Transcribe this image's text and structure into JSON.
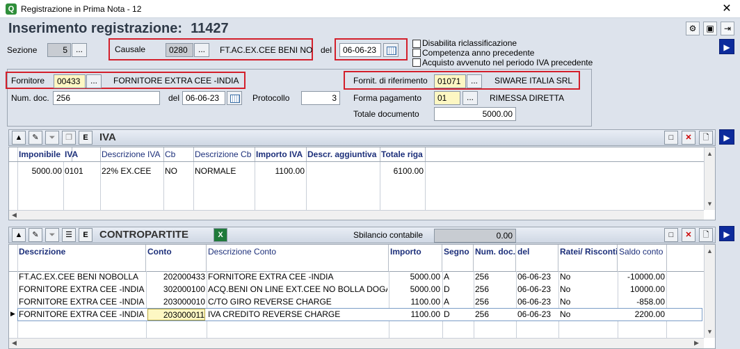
{
  "window": {
    "title": "Registrazione in Prima Nota - 12",
    "close_glyph": "✕"
  },
  "header": {
    "title": "Inserimento registrazione:",
    "number": "11427"
  },
  "form": {
    "sezione_label": "Sezione",
    "sezione_value": "5",
    "causale_label": "Causale",
    "causale_code": "0280",
    "causale_desc": "FT.AC.EX.CEE BENI NO",
    "del_label": "del",
    "causale_date": "06-06-23",
    "check1": "Disabilita riclassificazione",
    "check2": "Competenza anno precedente",
    "check3": "Acquisto avvenuto nel periodo IVA precedente",
    "fornitore_label": "Fornitore",
    "fornitore_code": "00433",
    "fornitore_name": "FORNITORE EXTRA CEE -INDIA",
    "numdoc_label": "Num. doc.",
    "numdoc_value": "256",
    "del2_label": "del",
    "numdoc_date": "06-06-23",
    "protocollo_label": "Protocollo",
    "protocollo_value": "3",
    "fornrif_label": "Fornit. di riferimento",
    "fornrif_code": "01071",
    "fornrif_name": "SIWARE ITALIA SRL",
    "pagamento_label": "Forma pagamento",
    "pagamento_code": "01",
    "pagamento_desc": "RIMESSA DIRETTA",
    "totale_label": "Totale documento",
    "totale_value": "5000.00",
    "dots": "..."
  },
  "iva": {
    "title": "IVA",
    "columns": [
      "Imponibile",
      "IVA",
      "Descrizione IVA",
      "Cb",
      "Descrizione Cb",
      "Importo IVA",
      "Descr. aggiuntiva",
      "Totale riga"
    ],
    "rows": [
      [
        "5000.00",
        "0101",
        "22% EX.CEE",
        "NO",
        "NORMALE",
        "1100.00",
        "",
        "6100.00"
      ]
    ]
  },
  "contropartite": {
    "title": "CONTROPARTITE",
    "sbilancio_label": "Sbilancio contabile",
    "sbilancio_value": "0.00",
    "columns": [
      "Descrizione",
      "Conto",
      "Descrizione Conto",
      "Importo",
      "Segno",
      "Num. doc.",
      "del",
      "Ratei/ Risconti",
      "Saldo conto"
    ],
    "rows": [
      [
        "FT.AC.EX.CEE BENI NOBOLLA",
        "202000433",
        "FORNITORE EXTRA CEE -INDIA",
        "5000.00",
        "A",
        "256",
        "06-06-23",
        "No",
        "-10000.00"
      ],
      [
        "FORNITORE EXTRA CEE -INDIA",
        "302000100",
        "ACQ.BENI ON LINE EXT.CEE NO BOLLA DOGA",
        "5000.00",
        "D",
        "256",
        "06-06-23",
        "No",
        "10000.00"
      ],
      [
        "FORNITORE EXTRA CEE -INDIA",
        "203000010",
        "C/TO GIRO REVERSE CHARGE",
        "1100.00",
        "A",
        "256",
        "06-06-23",
        "No",
        "-858.00"
      ],
      [
        "FORNITORE EXTRA CEE -INDIA",
        "203000011",
        "IVA CREDITO REVERSE CHARGE",
        "1100.00",
        "D",
        "256",
        "06-06-23",
        "No",
        "2200.00"
      ]
    ]
  },
  "icons": {
    "up": "▲",
    "right": "▶",
    "left": "◀",
    "down": "▼",
    "delete": "✕"
  }
}
